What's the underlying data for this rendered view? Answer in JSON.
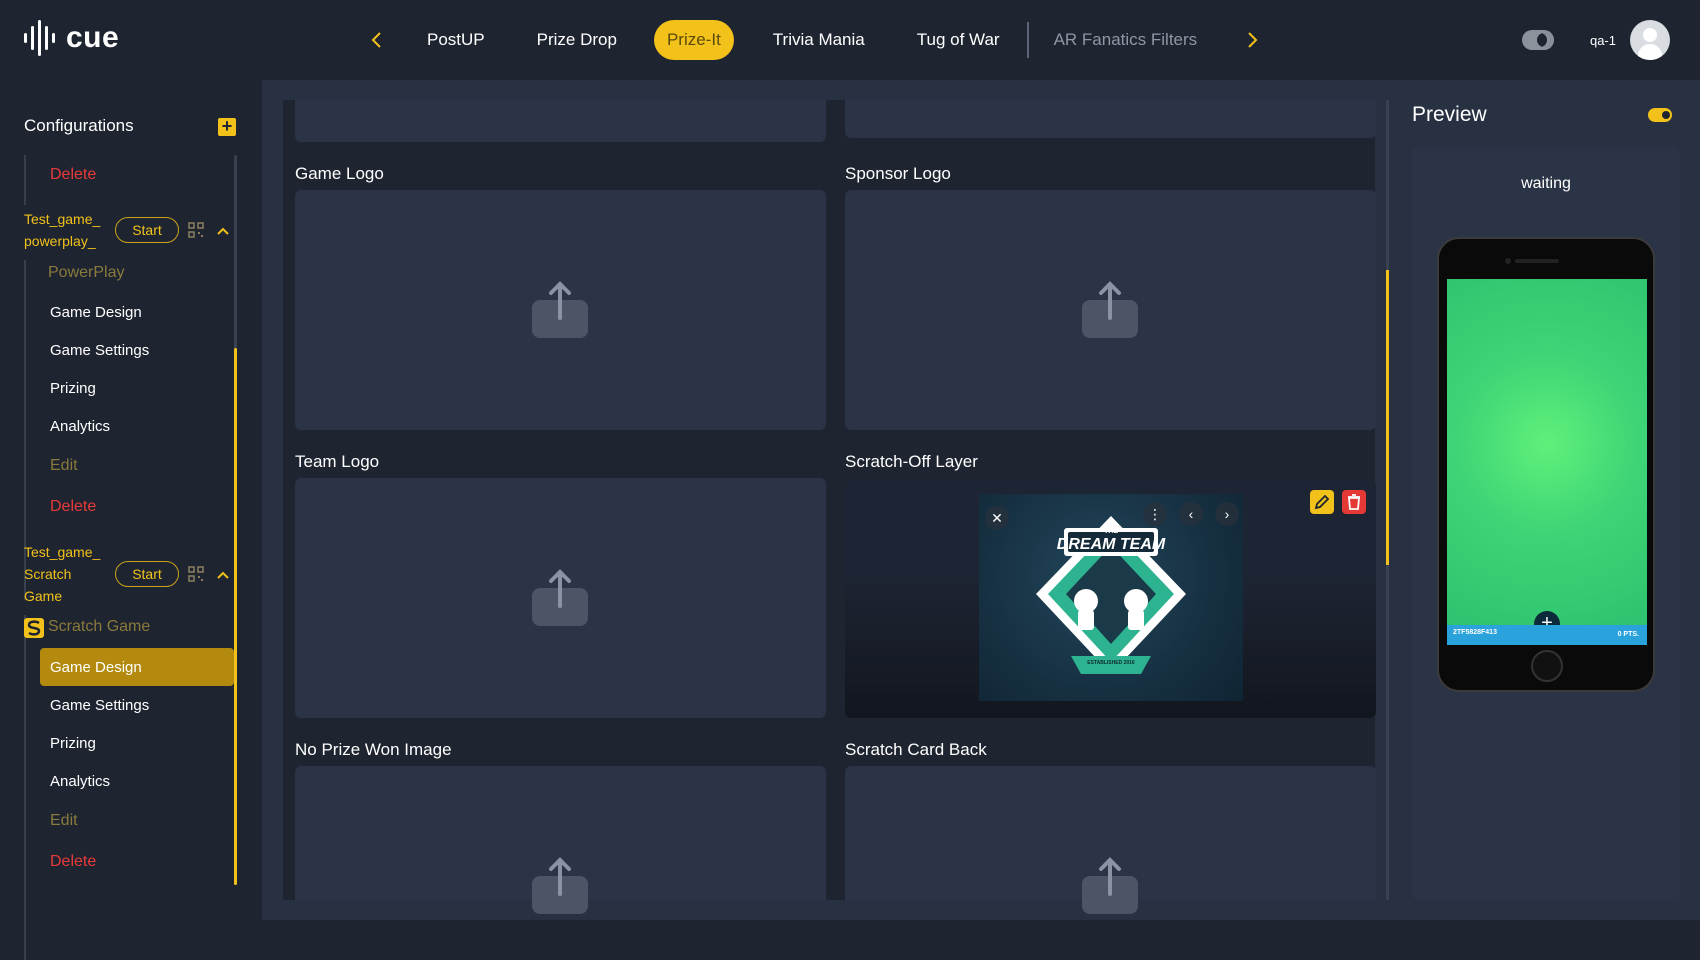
{
  "brand": {
    "logo_text": "cue"
  },
  "nav": {
    "tabs": [
      {
        "label": "PostUP"
      },
      {
        "label": "Prize Drop"
      },
      {
        "label": "Prize-It"
      },
      {
        "label": "Trivia Mania"
      },
      {
        "label": "Tug of War"
      },
      {
        "label": "AR Fanatics Filters"
      }
    ],
    "active_tab": "Prize-It"
  },
  "user": {
    "name": "qa-1"
  },
  "sidebar": {
    "header": "Configurations",
    "top_delete": "Delete",
    "games": [
      {
        "name": "Test_game_ powerplay_",
        "start_label": "Start",
        "type_label": "PowerPlay",
        "items": [
          "Game Design",
          "Game Settings",
          "Prizing",
          "Analytics"
        ],
        "edit_label": "Edit",
        "delete_label": "Delete"
      },
      {
        "name": "Test_game_ Scratch Game",
        "start_label": "Start",
        "type_label": "Scratch Game",
        "items": [
          "Game Design",
          "Game Settings",
          "Prizing",
          "Analytics"
        ],
        "edit_label": "Edit",
        "delete_label": "Delete"
      }
    ]
  },
  "fields": {
    "game_logo": "Game Logo",
    "sponsor_logo": "Sponsor Logo",
    "team_logo": "Team Logo",
    "scratch_off_layer": "Scratch-Off Layer",
    "no_prize_won_image": "No Prize Won Image",
    "scratch_card_back": "Scratch Card Back"
  },
  "scratch_image": {
    "line1": "THE",
    "line2": "DREAM TEAM",
    "ribbon": "ESTABLISHED 2016"
  },
  "preview": {
    "title": "Preview",
    "status": "waiting",
    "phone_bar_left": "2TF5828F413",
    "phone_bar_right": "0 PTS."
  },
  "colors": {
    "accent": "#f2c21a",
    "danger": "#e83a3a",
    "background": "#1e2430",
    "panel": "#2b3446"
  }
}
